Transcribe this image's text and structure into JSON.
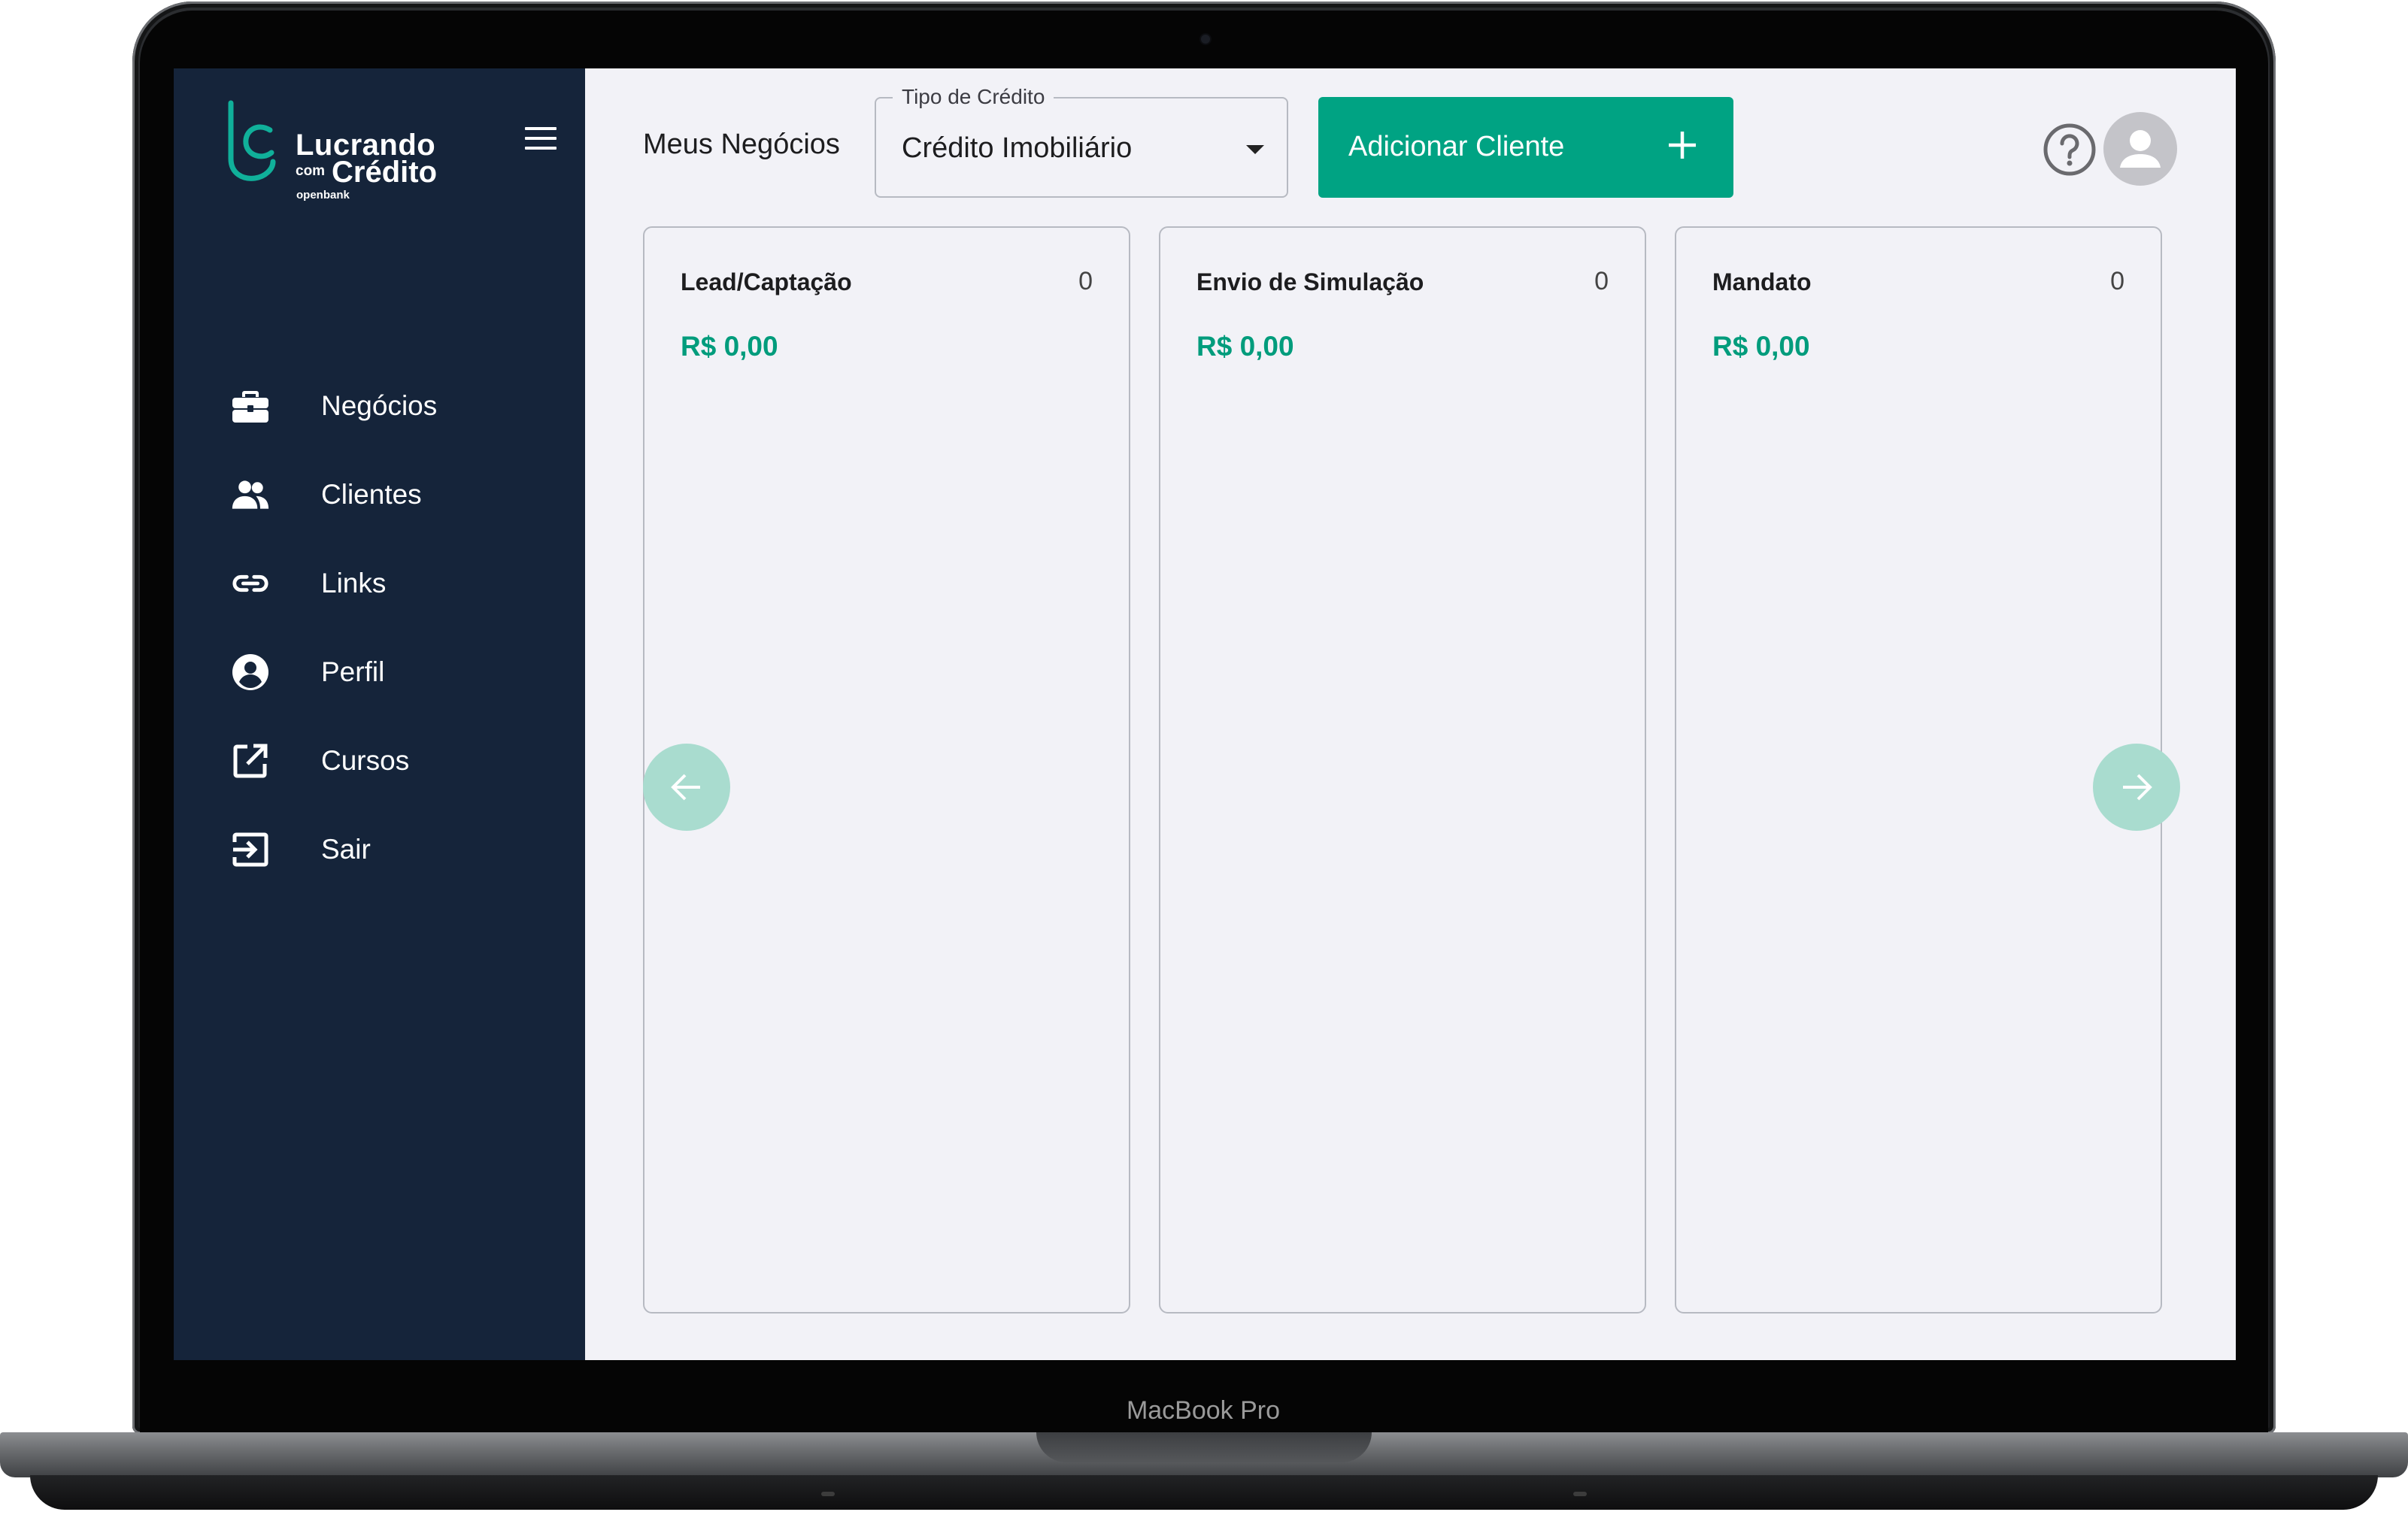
{
  "device": {
    "label": "MacBook Pro"
  },
  "brand": {
    "line1": "Lucrando",
    "connector": "com",
    "line2": "Crédito",
    "sub": "openbank"
  },
  "sidebar": {
    "items": [
      {
        "label": "Negócios",
        "icon": "briefcase-icon"
      },
      {
        "label": "Clientes",
        "icon": "people-icon"
      },
      {
        "label": "Links",
        "icon": "link-icon"
      },
      {
        "label": "Perfil",
        "icon": "account-circle-icon"
      },
      {
        "label": "Cursos",
        "icon": "external-link-icon"
      },
      {
        "label": "Sair",
        "icon": "logout-icon"
      }
    ]
  },
  "header": {
    "title": "Meus Negócios",
    "credit_type": {
      "label": "Tipo de Crédito",
      "value": "Crédito Imobiliário"
    },
    "add_button": "Adicionar Cliente"
  },
  "columns": [
    {
      "title": "Lead/Captação",
      "count": "0",
      "total": "R$ 0,00"
    },
    {
      "title": "Envio de Simulação",
      "count": "0",
      "total": "R$ 0,00"
    },
    {
      "title": "Mandato",
      "count": "0",
      "total": "R$ 0,00"
    }
  ],
  "colors": {
    "sidebar_bg": "#15243a",
    "accent": "#00a383",
    "total_text": "#009c7c",
    "arrow_bg": "#a9dccf",
    "page_bg": "#f2f2f7"
  }
}
